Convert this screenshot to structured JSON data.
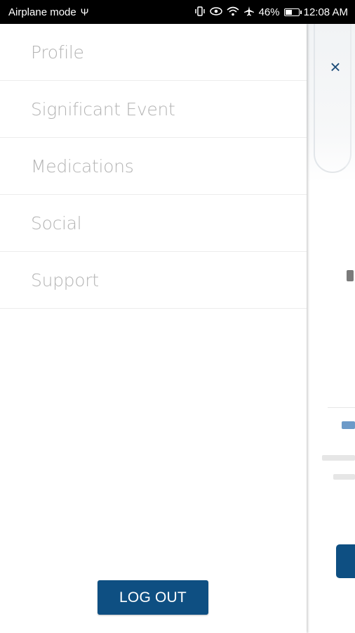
{
  "status_bar": {
    "left_text": "Airplane mode",
    "usb_icon": "Ψ",
    "battery_percent": "46%",
    "time": "12:08 AM",
    "icons": [
      "vibrate-icon",
      "eye-icon",
      "wifi-icon",
      "airplane-icon",
      "battery-icon"
    ]
  },
  "drawer": {
    "items": [
      {
        "label": "Profile"
      },
      {
        "label": "Significant Event"
      },
      {
        "label": "Medications"
      },
      {
        "label": "Social"
      },
      {
        "label": "Support"
      }
    ],
    "logout_label": "LOG OUT"
  },
  "background_screen": {
    "close_symbol": "×"
  },
  "colors": {
    "accent": "#0e4f82",
    "menu_text": "#b4b4b4",
    "status_bar": "#000000"
  }
}
